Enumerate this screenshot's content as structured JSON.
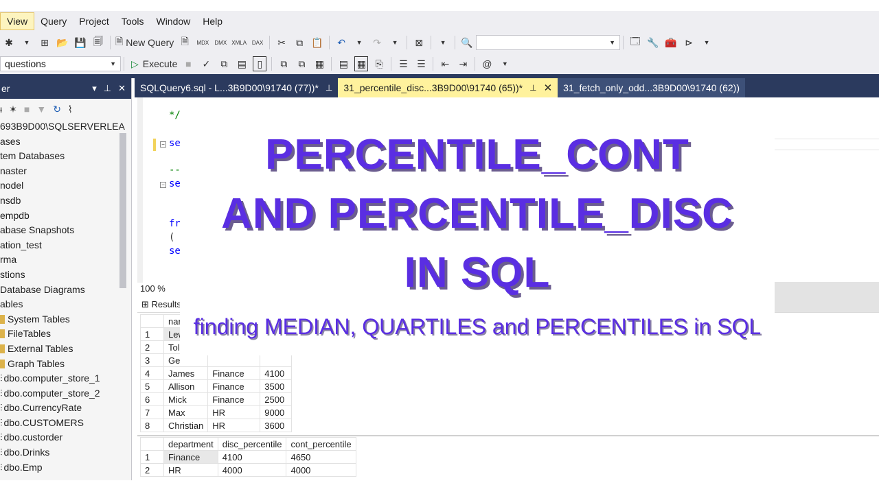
{
  "menu": {
    "items": [
      "View",
      "Query",
      "Project",
      "Tools",
      "Window",
      "Help"
    ]
  },
  "toolbar": {
    "new_query_label": "New Query",
    "execute_label": "Execute",
    "database_value": "questions"
  },
  "explorer": {
    "title": "er",
    "server": "693B9D00\\SQLSERVERLEA",
    "tree": [
      "ases",
      "tem Databases",
      "naster",
      "nodel",
      "nsdb",
      "empdb",
      "abase Snapshots",
      "ation_test",
      "rma",
      "stions",
      "Database Diagrams",
      "ables",
      "System Tables",
      "FileTables",
      "External Tables",
      "Graph Tables",
      "dbo.computer_store_1",
      "dbo.computer_store_2",
      "dbo.CurrencyRate",
      "dbo.CUSTOMERS",
      "dbo.custorder",
      "dbo.Drinks",
      "dbo.Emp"
    ]
  },
  "tabs": [
    {
      "label": "SQLQuery6.sql - L...3B9D00\\91740 (77))*",
      "active": false
    },
    {
      "label": "31_percentile_disc...3B9D00\\91740 (65))*",
      "active": true
    },
    {
      "label": "31_fetch_only_odd...3B9D00\\91740 (62))",
      "active": false
    }
  ],
  "editor": {
    "lines": [
      "*/",
      "se",
      "--",
      "se",
      "fr",
      "(",
      "se"
    ],
    "zoom": "100 %"
  },
  "overlay": {
    "line1": "PERCENTILE_CONT",
    "line2": "AND PERCENTILE_DISC",
    "line3": "IN SQL",
    "subtitle": "finding MEDIAN, QUARTILES and PERCENTILES in SQL"
  },
  "results": {
    "tab_label": "Results",
    "grid1": {
      "header": [
        "",
        "nar",
        "",
        ""
      ],
      "rows": [
        [
          "1",
          "Lew",
          "",
          ""
        ],
        [
          "2",
          "Tol",
          "",
          ""
        ],
        [
          "3",
          "Ge",
          "",
          ""
        ],
        [
          "4",
          "James",
          "Finance",
          "4100"
        ],
        [
          "5",
          "Allison",
          "Finance",
          "3500"
        ],
        [
          "6",
          "Mick",
          "Finance",
          "2500"
        ],
        [
          "7",
          "Max",
          "HR",
          "9000"
        ],
        [
          "8",
          "Christian",
          "HR",
          "3600"
        ]
      ]
    },
    "grid2": {
      "header": [
        "",
        "department",
        "disc_percentile",
        "cont_percentile"
      ],
      "rows": [
        [
          "1",
          "Finance",
          "4100",
          "4650"
        ],
        [
          "2",
          "HR",
          "4000",
          "4000"
        ]
      ]
    }
  },
  "colors": {
    "accent": "#5a2ee2",
    "tab_active": "#fff29d",
    "titlebar": "#2b3a5e"
  }
}
